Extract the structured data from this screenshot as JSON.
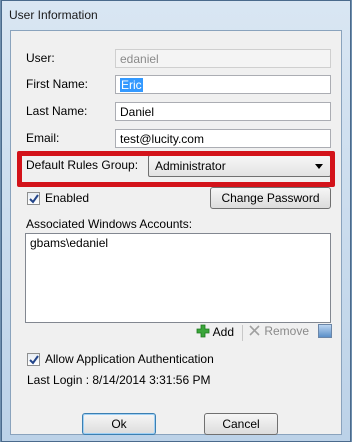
{
  "window": {
    "title": "User Information"
  },
  "form": {
    "user_label": "User:",
    "user_value": "edaniel",
    "first_name_label": "First Name:",
    "first_name_value": "Eric",
    "last_name_label": "Last Name:",
    "last_name_value": "Daniel",
    "email_label": "Email:",
    "email_value": "test@lucity.com",
    "rules_group_label": "Default Rules Group:",
    "rules_group_value": "Administrator",
    "enabled_label": "Enabled",
    "change_password_label": "Change Password",
    "windows_accounts_label": "Associated Windows Accounts:",
    "windows_accounts": [
      "gbams\\edaniel"
    ],
    "add_label": "Add",
    "remove_label": "Remove",
    "allow_app_auth_label": "Allow Application Authentication",
    "last_login_text": "Last Login : 8/14/2014 3:31:56 PM",
    "ok_label": "Ok",
    "cancel_label": "Cancel"
  },
  "colors": {
    "highlight": "#d3131a",
    "selection": "#3399ff"
  }
}
